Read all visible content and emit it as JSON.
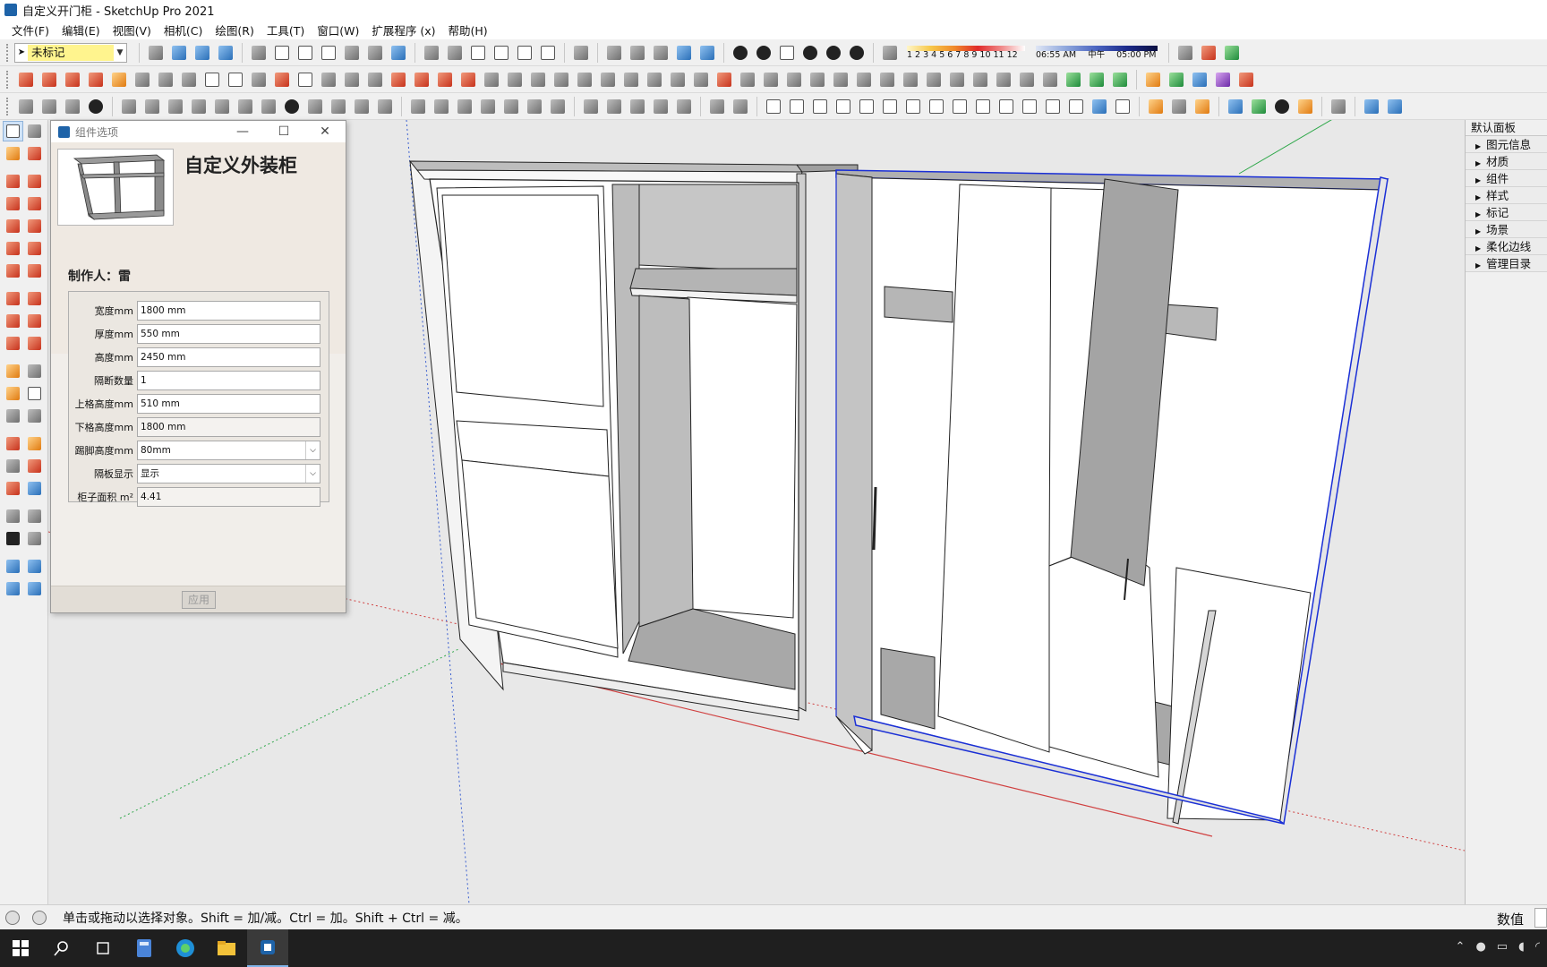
{
  "window": {
    "title": "自定义开门柜 - SketchUp Pro 2021"
  },
  "menu": [
    "文件(F)",
    "编辑(E)",
    "视图(V)",
    "相机(C)",
    "绘图(R)",
    "工具(T)",
    "窗口(W)",
    "扩展程序 (x)",
    "帮助(H)"
  ],
  "tag_selector": {
    "value": "未标记"
  },
  "shadow": {
    "months": [
      "1",
      "2",
      "3",
      "4",
      "5",
      "6",
      "7",
      "8",
      "9",
      "10",
      "11",
      "12"
    ],
    "time_start": "06:55 AM",
    "time_mid": "中午",
    "time_end": "05:00 PM"
  },
  "dialog": {
    "title": "组件选项",
    "component_name": "自定义外装柜",
    "author": "制作人：雷",
    "fields": [
      {
        "label": "宽度mm",
        "value": "1800 mm",
        "type": "input"
      },
      {
        "label": "厚度mm",
        "value": "550 mm",
        "type": "input"
      },
      {
        "label": "高度mm",
        "value": "2450 mm",
        "type": "input"
      },
      {
        "label": "隔断数量",
        "value": "1",
        "type": "input"
      },
      {
        "label": "上格高度mm",
        "value": "510 mm",
        "type": "input"
      },
      {
        "label": "下格高度mm",
        "value": "1800 mm",
        "type": "readonly"
      },
      {
        "label": "踢脚高度mm",
        "value": "80mm",
        "type": "select"
      },
      {
        "label": "隔板显示",
        "value": "显示",
        "type": "select"
      },
      {
        "label": "柜子面积 m²",
        "value": "4.41",
        "type": "readonly"
      }
    ],
    "apply_label": "应用"
  },
  "tray": {
    "title": "默认面板",
    "items": [
      "图元信息",
      "材质",
      "组件",
      "样式",
      "标记",
      "场景",
      "柔化边线",
      "管理目录"
    ]
  },
  "status": {
    "text": "单击或拖动以选择对象。Shift = 加/减。Ctrl = 加。Shift + Ctrl = 减。",
    "measurements_label": "数值"
  },
  "colors": {
    "selection": "#1a2fd6",
    "axis_red": "#d04040",
    "axis_green": "#2fa84a",
    "axis_blue": "#3a5fd0"
  }
}
